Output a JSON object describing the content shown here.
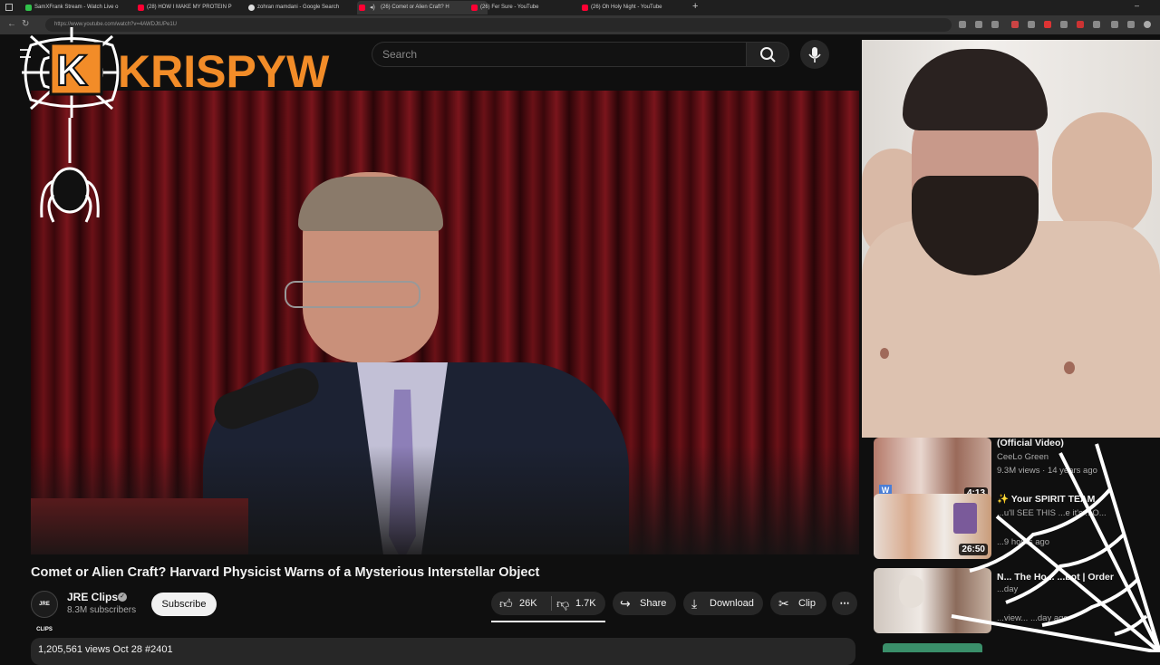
{
  "browser": {
    "tabs": [
      {
        "label": "SamXFrank Stream - Watch Live o"
      },
      {
        "label": "(28) HOW I MAKE MY PROTEIN P"
      },
      {
        "label": "zohran mamdani - Google Search"
      },
      {
        "label": "(26) Comet or Alien Craft? H"
      },
      {
        "label": "(26) Fer Sure - YouTube"
      },
      {
        "label": "(26) Oh Holy Night - YouTube"
      }
    ],
    "url": "https://www.youtube.com/watch?v=4AWDJtUPe1U"
  },
  "overlay": {
    "logo_text": "KRISPYW"
  },
  "youtube": {
    "search_placeholder": "Search",
    "video": {
      "title": "Comet or Alien Craft? Harvard Physicist Warns of a Mysterious Interstellar Object",
      "channel": "JRE Clips",
      "avatar_text": "JRE CLIPS",
      "subscribers": "8.3M subscribers",
      "subscribe_label": "Subscribe",
      "likes": "26K",
      "dislikes": "1.7K",
      "share_label": "Share",
      "download_label": "Download",
      "clip_label": "Clip",
      "description_preview": "1,205,561 views  Oct 28  #2401"
    },
    "recommendations": [
      {
        "title": "(Official Video)",
        "channel": "CeeLo Green",
        "meta": "9.3M views · 14 years ago",
        "duration": "4:13"
      },
      {
        "title": "✨ Your SPIRIT TEAM",
        "channel": "...u'll SEE THIS ...e it's ...O...",
        "meta": "...9 hours ago",
        "duration": "26:50"
      },
      {
        "title": "N... The Ho... ...bot | Order",
        "channel": "...day",
        "meta": "...view... ...day ago",
        "duration": ""
      }
    ]
  },
  "colors": {
    "accent": "#f28c28",
    "background": "#0f0f0f",
    "youtube_red": "#ff0033"
  }
}
